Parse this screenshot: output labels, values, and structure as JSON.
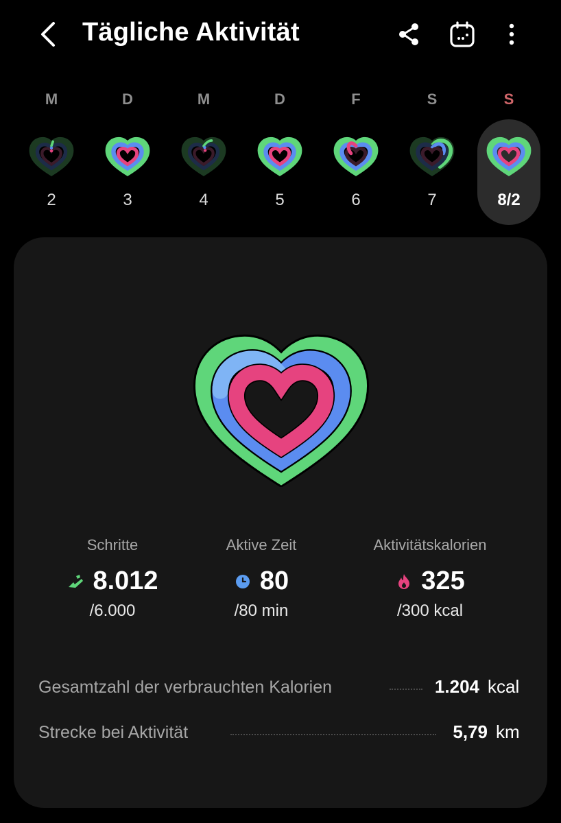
{
  "header": {
    "title": "Tägliche Aktivität",
    "back_icon": "chevron-left-icon",
    "share_icon": "share-icon",
    "calendar_icon": "calendar-icon",
    "more_icon": "more-vertical-icon"
  },
  "week": {
    "days": [
      {
        "letter": "M",
        "date": "2"
      },
      {
        "letter": "D",
        "date": "3"
      },
      {
        "letter": "M",
        "date": "4"
      },
      {
        "letter": "D",
        "date": "5"
      },
      {
        "letter": "F",
        "date": "6"
      },
      {
        "letter": "S",
        "date": "7"
      },
      {
        "letter": "S",
        "date": "8/2"
      }
    ],
    "selected_index": 6,
    "sunday_color": "#d0666a"
  },
  "rings_colors": {
    "steps": "#5fd67a",
    "active_time": "#5b8cf0",
    "calories": "#e6437f"
  },
  "stats": {
    "steps": {
      "label": "Schritte",
      "value": "8.012",
      "goal": "/6.000",
      "icon": "running-shoe-icon"
    },
    "active_time": {
      "label": "Aktive Zeit",
      "value": "80",
      "goal": "/80 min",
      "icon": "clock-icon"
    },
    "calories": {
      "label": "Aktivitätskalorien",
      "value": "325",
      "goal": "/300 kcal",
      "icon": "flame-icon"
    }
  },
  "details": {
    "total_calories": {
      "label": "Gesamtzahl der verbrauchten Kalorien",
      "value": "1.204",
      "unit": "kcal"
    },
    "distance": {
      "label": "Strecke bei Aktivität",
      "value": "5,79",
      "unit": "km"
    }
  }
}
